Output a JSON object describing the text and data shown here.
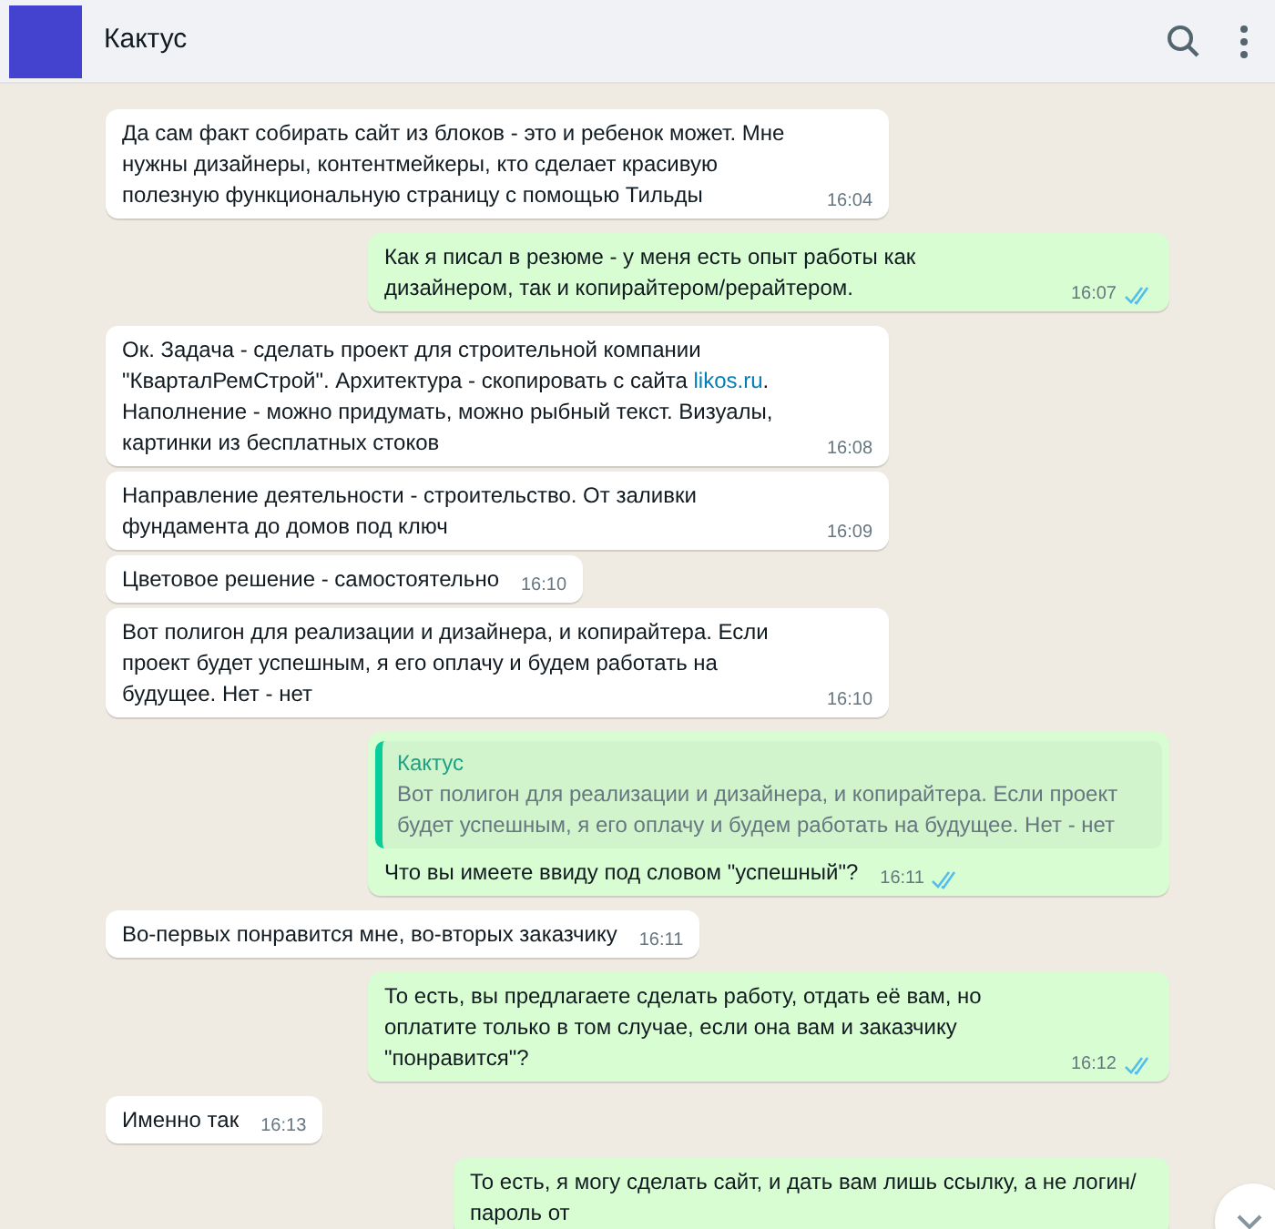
{
  "header": {
    "title": "Кактус"
  },
  "messages": [
    {
      "kind": "incoming",
      "parts": [
        {
          "text": "Да сам факт собирать сайт из блоков - это и ребенок может. Мне нужны дизайнеры, контентмейкеры, кто сделает красивую полезную функциональную страницу с помощью Тильды"
        }
      ],
      "time": "16:04"
    },
    {
      "kind": "outgoing",
      "parts": [
        {
          "text": "Как я писал в резюме - у меня есть опыт работы как дизайнером, так и копирайтером/рерайтером."
        }
      ],
      "time": "16:07",
      "read": true
    },
    {
      "kind": "incoming",
      "parts": [
        {
          "text": "Ок. Задача - сделать проект для строительной компании \"КварталРемСтрой\". Архитектура - скопировать с сайта "
        },
        {
          "kind": "link",
          "text": "likos.ru"
        },
        {
          "text": ". Наполнение - можно придумать, можно рыбный текст. Визуалы, картинки из бесплатных стоков"
        }
      ],
      "time": "16:08"
    },
    {
      "kind": "incoming",
      "parts": [
        {
          "text": "Направление деятельности - строительство. От заливки фундамента до домов под ключ"
        }
      ],
      "time": "16:09"
    },
    {
      "kind": "incoming",
      "parts": [
        {
          "text": "Цветовое решение - самостоятельно"
        }
      ],
      "time": "16:10"
    },
    {
      "kind": "incoming",
      "parts": [
        {
          "text": "Вот полигон для реализации и дизайнера, и копирайтера. Если проект будет успешным, я его оплачу и будем работать на будущее. Нет - нет"
        }
      ],
      "time": "16:10"
    },
    {
      "kind": "outgoing",
      "quote": {
        "author": "Кактус",
        "text": "Вот полигон для реализации и дизайнера, и копирайтера. Если проект будет успешным, я его оплачу и будем работать на будущее. Нет - нет"
      },
      "parts": [
        {
          "text": "Что вы имеете ввиду под словом \"успешный\"?"
        }
      ],
      "time": "16:11",
      "read": true
    },
    {
      "kind": "incoming",
      "parts": [
        {
          "text": "Во-первых понравится мне, во-вторых заказчику"
        }
      ],
      "time": "16:11"
    },
    {
      "kind": "outgoing",
      "parts": [
        {
          "text": "То есть, вы предлагаете сделать работу, отдать её вам, но оплатите только в том случае, если она вам и заказчику \"понравится\"?"
        }
      ],
      "time": "16:12",
      "read": true
    },
    {
      "kind": "incoming",
      "parts": [
        {
          "text": "Именно так"
        }
      ],
      "time": "16:13"
    },
    {
      "kind": "outgoing",
      "parts": [
        {
          "text": "То есть, я могу сделать сайт, и дать вам лишь ссылку, а не логин/пароль от"
        }
      ]
    }
  ]
}
